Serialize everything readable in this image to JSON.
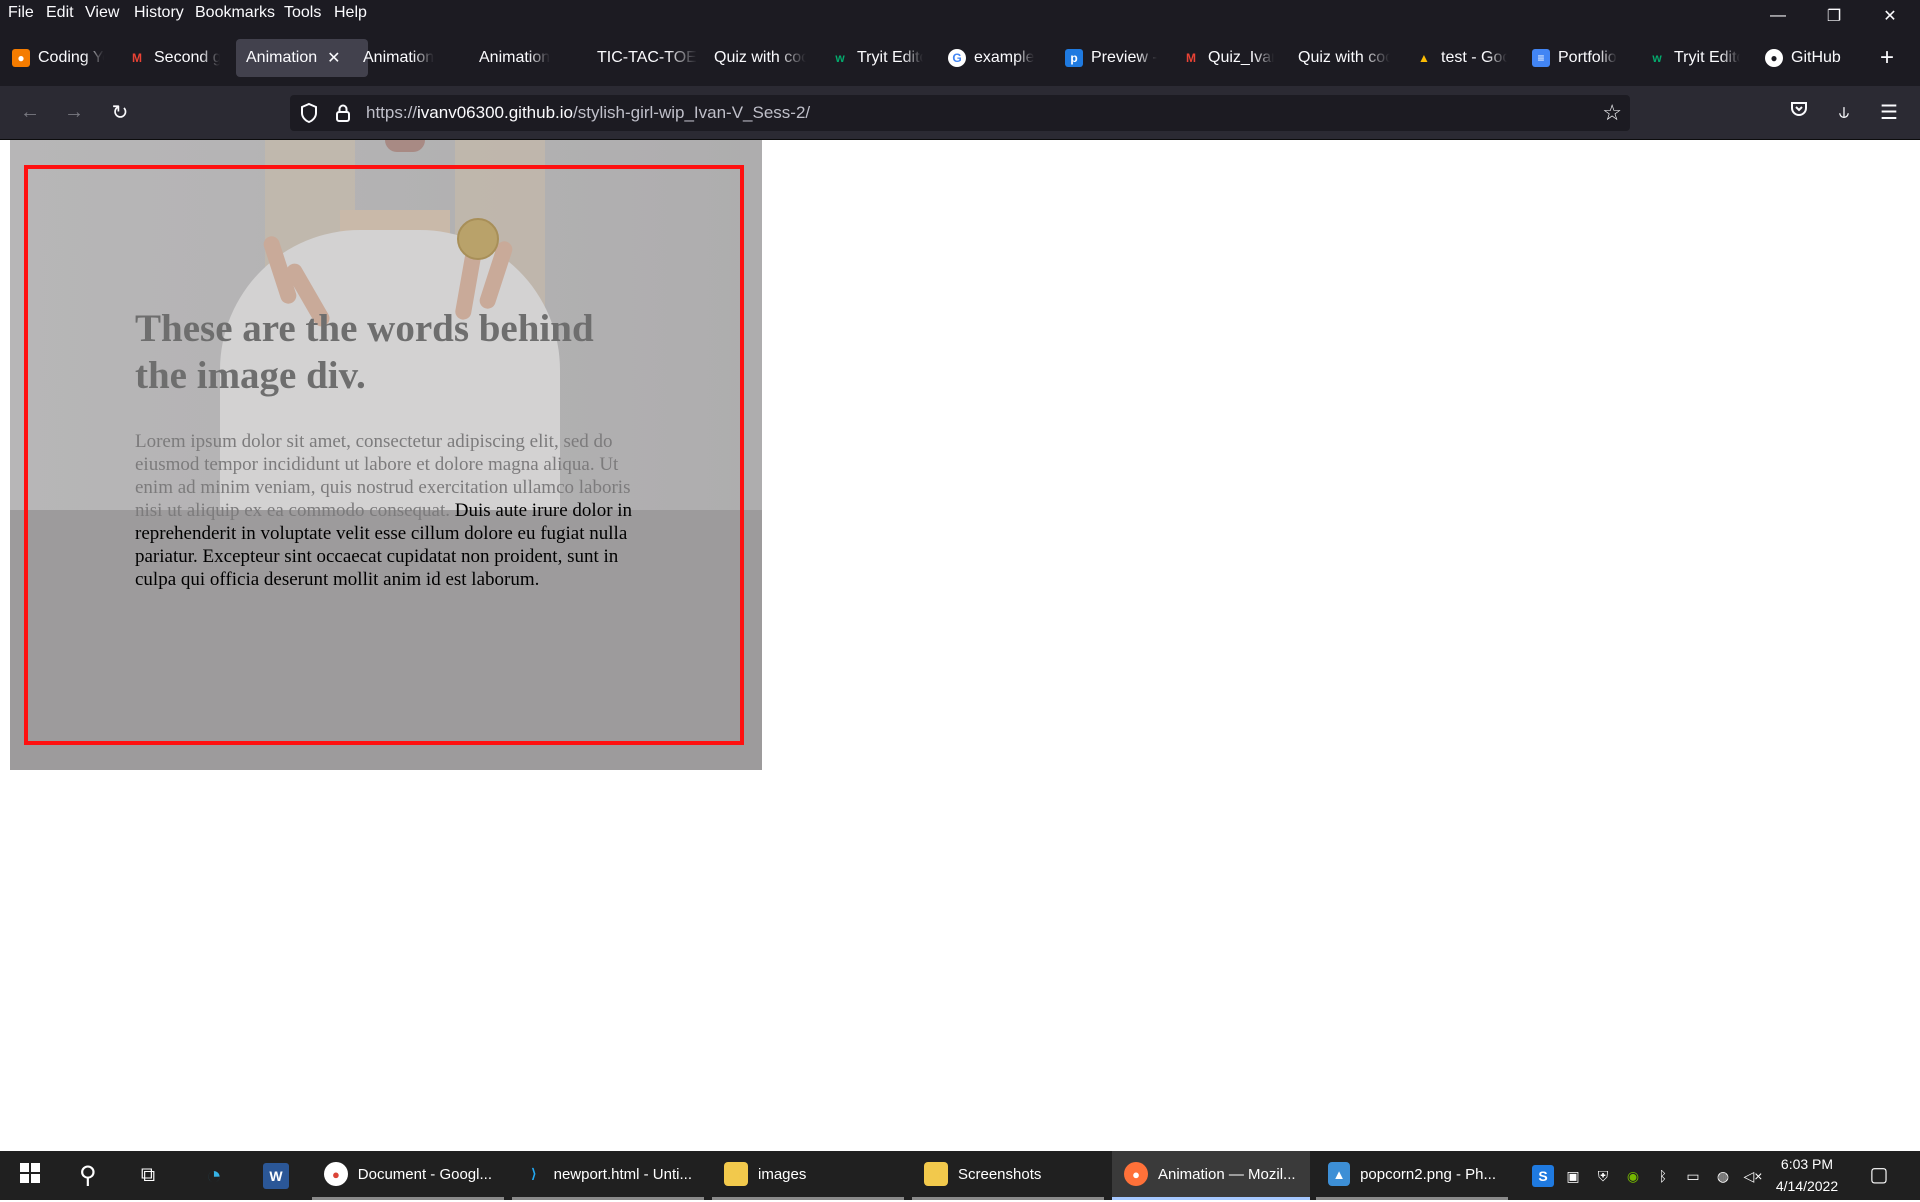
{
  "menubar": {
    "items": [
      "File",
      "Edit",
      "View",
      "History",
      "Bookmarks",
      "Tools",
      "Help"
    ],
    "underline": [
      "F",
      "E",
      "V",
      "s",
      "B",
      "T",
      "H"
    ],
    "rest": [
      "ile",
      "dit",
      "iew",
      "History",
      "ookmarks",
      "ools",
      "elp"
    ]
  },
  "window_controls": {
    "minimize": "—",
    "restore": "❐",
    "close": "✕"
  },
  "tabs": [
    {
      "label": "Coding Ye",
      "icon": "coding-icon",
      "color": "#f57c00"
    },
    {
      "label": "Second g",
      "icon": "gmail-icon",
      "color": "#ea4335"
    },
    {
      "label": "Animation",
      "icon": "",
      "active": true
    },
    {
      "label": "Animation",
      "icon": ""
    },
    {
      "label": "Animation",
      "icon": ""
    },
    {
      "label": "TIC-TAC-TOE",
      "icon": ""
    },
    {
      "label": "Quiz with coc",
      "icon": ""
    },
    {
      "label": "Tryit Edito",
      "icon": "w3schools-icon",
      "color": "#04aa6d"
    },
    {
      "label": "example",
      "icon": "google-icon",
      "color": "#4285f4"
    },
    {
      "label": "Preview -",
      "icon": "p-icon",
      "color": "#1f7ae0"
    },
    {
      "label": "Quiz_Ivan",
      "icon": "gmail-icon",
      "color": "#ea4335"
    },
    {
      "label": "Quiz with coc",
      "icon": ""
    },
    {
      "label": "test - Goo",
      "icon": "drive-icon",
      "color": "#fbbc04"
    },
    {
      "label": "Portfolio",
      "icon": "docs-icon",
      "color": "#4285f4"
    },
    {
      "label": "Tryit Edito",
      "icon": "w3schools-icon",
      "color": "#04aa6d"
    },
    {
      "label": "GitHub",
      "icon": "github-icon",
      "color": "#ffffff"
    }
  ],
  "url": {
    "scheme": "https://",
    "host": "ivanv06300.github.io",
    "path": "/stylish-girl-wip_Ivan-V_Sess-2/"
  },
  "page": {
    "heading": "These are the words behind the image div.",
    "para_faded": "Lorem ipsum dolor sit amet, consectetur adipiscing elit, sed do eiusmod tempor incididunt ut labore et dolore magna aliqua. Ut enim ad minim veniam, quis nostrud exercitation ullamco laboris nisi ut aliquip ex ea commodo consequat.",
    "para_visible": "Duis aute irure dolor in reprehenderit in voluptate velit esse cillum dolore eu fugiat nulla pariatur. Excepteur sint occaecat cupidatat non proident, sunt in culpa qui officia deserunt mollit anim id est laborum."
  },
  "taskbar": {
    "apps": [
      {
        "label": "Document - Googl...",
        "icon": "chrome-icon"
      },
      {
        "label": "newport.html - Unti...",
        "icon": "vscode-icon"
      },
      {
        "label": "images",
        "icon": "folder-icon"
      },
      {
        "label": "Screenshots",
        "icon": "folder-icon"
      },
      {
        "label": "Animation — Mozil...",
        "icon": "firefox-icon",
        "active": true
      },
      {
        "label": "popcorn2.png - Ph...",
        "icon": "photos-icon"
      }
    ],
    "time": "6:03 PM",
    "date": "4/14/2022"
  }
}
